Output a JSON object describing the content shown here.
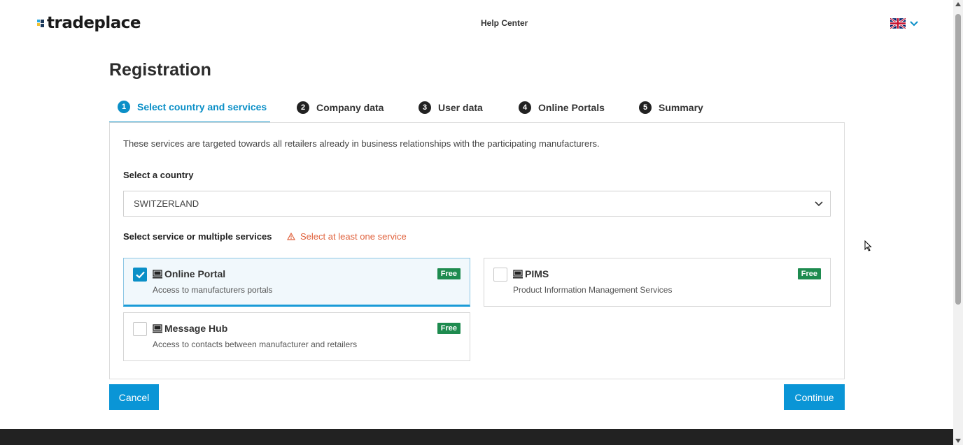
{
  "header": {
    "logo_text": "tradeplace",
    "help_center": "Help Center",
    "language": "English (UK)"
  },
  "page": {
    "title": "Registration"
  },
  "steps": [
    {
      "number": "1",
      "label": "Select country and services",
      "active": true
    },
    {
      "number": "2",
      "label": "Company data",
      "active": false
    },
    {
      "number": "3",
      "label": "User data",
      "active": false
    },
    {
      "number": "4",
      "label": "Online Portals",
      "active": false
    },
    {
      "number": "5",
      "label": "Summary",
      "active": false
    }
  ],
  "form": {
    "intro": "These services are targeted towards all retailers already in business relationships with the participating manufacturers.",
    "country_label": "Select a country",
    "country_value": "SWITZERLAND",
    "service_label": "Select service or multiple services",
    "service_warning": "Select at least one service"
  },
  "services": [
    {
      "title": "Online Portal",
      "description": "Access to manufacturers portals",
      "badge": "Free",
      "checked": true
    },
    {
      "title": "PIMS",
      "description": "Product Information Management Services",
      "badge": "Free",
      "checked": false
    },
    {
      "title": "Message Hub",
      "description": "Access to contacts between manufacturer and retailers",
      "badge": "Free",
      "checked": false
    }
  ],
  "actions": {
    "cancel": "Cancel",
    "continue": "Continue"
  },
  "colors": {
    "accent": "#0a8fc7",
    "button": "#0a95d6",
    "warning": "#e0623d",
    "badge": "#1e8b4f"
  }
}
